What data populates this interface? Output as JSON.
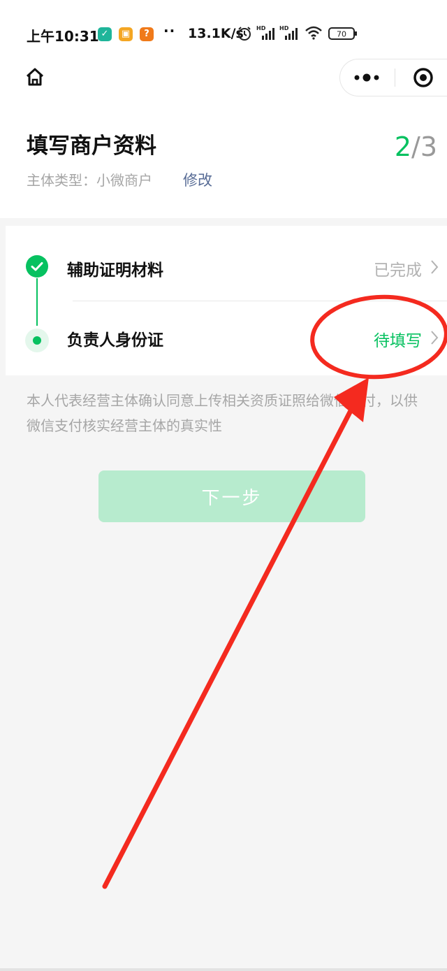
{
  "status_bar": {
    "time": "上午10:31",
    "dots": "··",
    "network_speed": "13.1K/s",
    "signal_1_label": "HD",
    "signal_2_label": "HD",
    "battery": "70",
    "icons": [
      "shield-app-icon",
      "gallery-app-icon",
      "notification-app-icon",
      "alarm-icon",
      "signal-icon",
      "signal-icon",
      "wifi-icon",
      "battery-icon"
    ],
    "colors": {
      "shield": "#1fb59a",
      "gallery": "#f4a623",
      "notification": "#f07a1a"
    }
  },
  "nav": {
    "home_icon": "home-icon",
    "more_icon": "more-dots-icon",
    "close_icon": "target-close-icon"
  },
  "header": {
    "title": "填写商户资料",
    "step_current": "2",
    "step_sep": "/",
    "step_total": "3",
    "subject_label": "主体类型：小微商户",
    "edit_link": "修改"
  },
  "steps": [
    {
      "label": "辅助证明材料",
      "status": "已完成",
      "state": "done"
    },
    {
      "label": "负责人身份证",
      "status": "待填写",
      "state": "pending"
    }
  ],
  "consent": "本人代表经营主体确认同意上传相关资质证照给微信支付，以供微信支付核实经营主体的真实性",
  "next_button": "下一步",
  "colors": {
    "accent": "#07c160",
    "accent_disabled": "#b7ebce",
    "link": "#576b95",
    "annotation": "#f42a1f"
  }
}
